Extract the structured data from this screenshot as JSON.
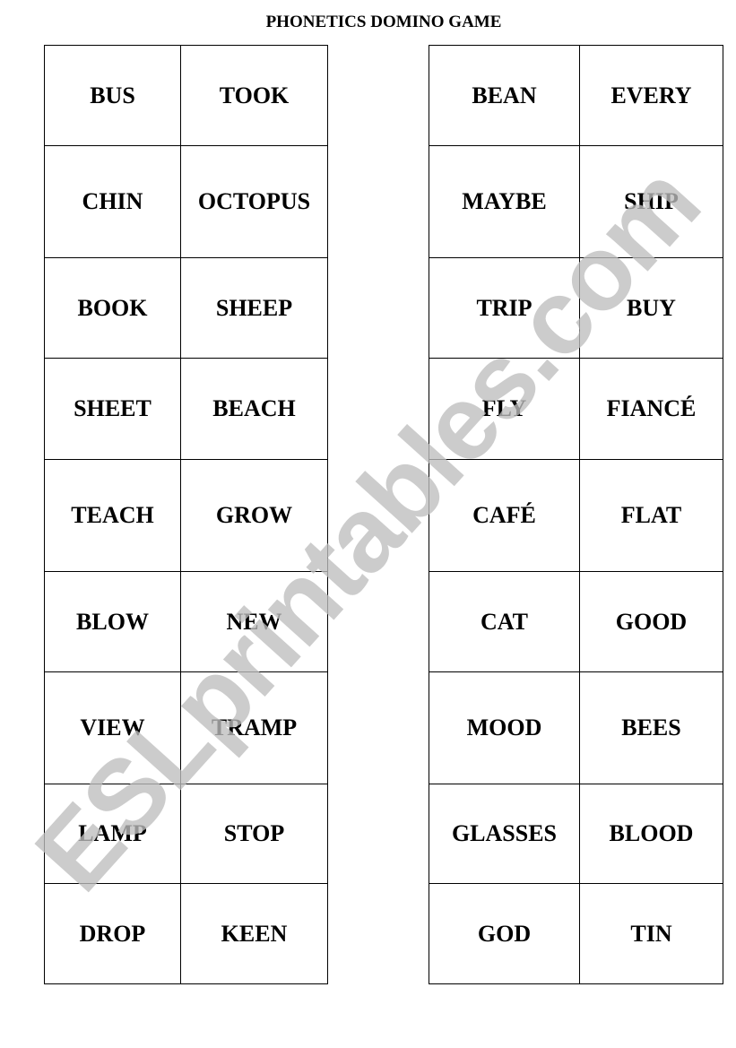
{
  "title": "PHONETICS DOMINO GAME",
  "watermark": "ESLprintables.com",
  "left_table": {
    "rows": [
      [
        "BUS",
        "TOOK"
      ],
      [
        "CHIN",
        "OCTOPUS"
      ],
      [
        "BOOK",
        "SHEEP"
      ],
      [
        "SHEET",
        "BEACH"
      ],
      [
        "TEACH",
        "GROW"
      ],
      [
        "BLOW",
        "NEW"
      ],
      [
        "VIEW",
        "TRAMP"
      ],
      [
        "LAMP",
        "STOP"
      ],
      [
        "DROP",
        "KEEN"
      ]
    ]
  },
  "right_table": {
    "rows": [
      [
        "BEAN",
        "EVERY"
      ],
      [
        "MAYBE",
        "SHIP"
      ],
      [
        "TRIP",
        "BUY"
      ],
      [
        "FLY",
        "FIANCÉ"
      ],
      [
        "CAFÉ",
        "FLAT"
      ],
      [
        "CAT",
        "GOOD"
      ],
      [
        "MOOD",
        "BEES"
      ],
      [
        "GLASSES",
        "BLOOD"
      ],
      [
        "GOD",
        "TIN"
      ]
    ]
  }
}
